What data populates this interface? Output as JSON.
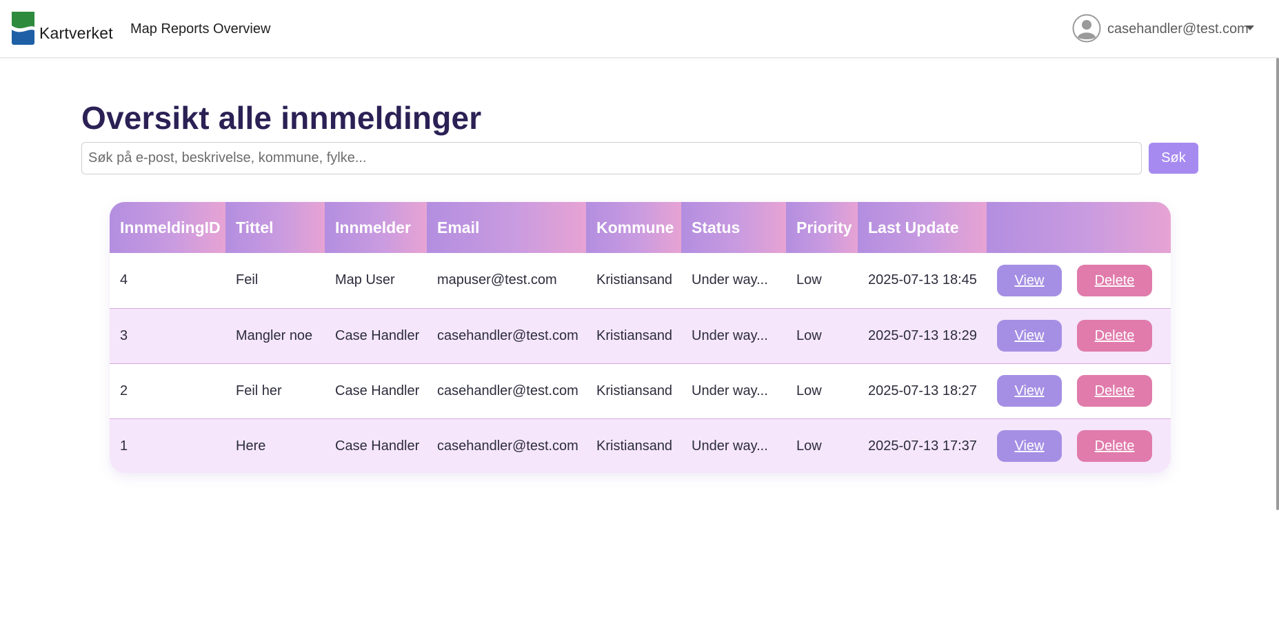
{
  "navbar": {
    "brand": "Kartverket",
    "nav_link": "Map Reports Overview",
    "user_email": "casehandler@test.com",
    "icons": {
      "logo": "kartverket-logo",
      "avatar": "user-avatar-icon",
      "caret": "chevron-down-icon"
    }
  },
  "page": {
    "title": "Oversikt alle innmeldinger",
    "search_placeholder": "Søk på e-post, beskrivelse, kommune, fylke...",
    "search_value": "",
    "search_button": "Søk"
  },
  "table": {
    "columns": [
      "InnmeldingID",
      "Tittel",
      "Innmelder",
      "Email",
      "Kommune",
      "Status",
      "Priority",
      "Last Update",
      ""
    ],
    "rows": [
      {
        "id": "4",
        "title": "Feil",
        "reporter": "Map User",
        "email": "mapuser@test.com",
        "municipality": "Kristiansand",
        "status": "Under way...",
        "priority": "Low",
        "last_update": "2025-07-13 18:45",
        "view": "View",
        "delete": "Delete"
      },
      {
        "id": "3",
        "title": "Mangler noe",
        "reporter": "Case Handler",
        "email": "casehandler@test.com",
        "municipality": "Kristiansand",
        "status": "Under way...",
        "priority": "Low",
        "last_update": "2025-07-13 18:29",
        "view": "View",
        "delete": "Delete"
      },
      {
        "id": "2",
        "title": "Feil her",
        "reporter": "Case Handler",
        "email": "casehandler@test.com",
        "municipality": "Kristiansand",
        "status": "Under way...",
        "priority": "Low",
        "last_update": "2025-07-13 18:27",
        "view": "View",
        "delete": "Delete"
      },
      {
        "id": "1",
        "title": "Here",
        "reporter": "Case Handler",
        "email": "casehandler@test.com",
        "municipality": "Kristiansand",
        "status": "Under way...",
        "priority": "Low",
        "last_update": "2025-07-13 17:37",
        "view": "View",
        "delete": "Delete"
      }
    ]
  },
  "colors": {
    "title": "#2b2155",
    "search_button": "#a68af0",
    "header_gradient_start": "#b38ee0",
    "header_gradient_end": "#e7a3d3",
    "row_alt": "#f5e6fb",
    "view_button": "#a58fe4",
    "delete_button": "#e07bab"
  }
}
